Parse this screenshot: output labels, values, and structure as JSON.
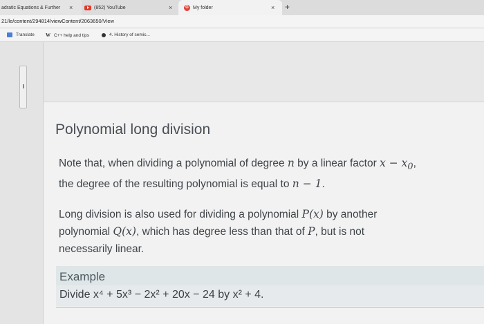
{
  "browser": {
    "tabs": [
      {
        "title": "adratic Equations & Further",
        "close": "×"
      },
      {
        "title": "(852) YouTube",
        "close": "×"
      },
      {
        "title": "My folder",
        "close": "×"
      }
    ],
    "new_tab": "+",
    "url": "21/le/content/294814/viewContent/2063650/View",
    "bookmarks": [
      "Translate",
      "C++ help and tips",
      "4. History of semic..."
    ],
    "icons": [
      "youtube-icon",
      "google-icon",
      "translate-icon",
      "wikipedia-icon"
    ]
  },
  "lesson": {
    "heading": "Polynomial long division",
    "para1_line1_a": "Note that, when dividing a polynomial of degree ",
    "para1_var_n": "n",
    "para1_line1_b": " by a linear factor ",
    "para1_expr": "x − x",
    "para1_sub": "0",
    "para1_trail": ",",
    "para1_line2_a": "the degree of the resulting polynomial is equal to ",
    "para1_line2_expr": "n − 1",
    "para1_line2_b": ".",
    "para2_line1_a": "Long division is also used for dividing a polynomial ",
    "para2_P": "P(x)",
    "para2_line1_b": " by another",
    "para2_line2_a": "polynomial ",
    "para2_Q": "Q(x)",
    "para2_line2_b": ", which has degree less than that of ",
    "para2_P2": "P",
    "para2_line2_c": ", but is not",
    "para2_line3": "necessarily linear.",
    "example_title": "Example",
    "example_prefix": "Divide ",
    "example_expr": "x⁴ + 5x³ − 2x² + 20x − 24",
    "example_mid": " by ",
    "example_divisor": "x² + 4",
    "example_end": "."
  }
}
